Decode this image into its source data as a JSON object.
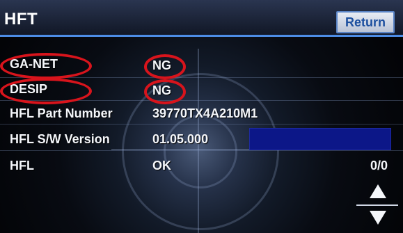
{
  "header": {
    "title": "HFT",
    "return_label": "Return"
  },
  "rows": [
    {
      "label": "GA-NET",
      "value": "NG"
    },
    {
      "label": "DESIP",
      "value": "NG"
    },
    {
      "label": "HFL Part Number",
      "value": "39770TX4A210M1"
    },
    {
      "label": "HFL S/W Version",
      "value": "01.05.000"
    },
    {
      "label": "HFL",
      "value": "OK"
    }
  ],
  "page_counter": "0/0",
  "controls": {
    "scroll_up_icon": "triangle-up",
    "scroll_down_icon": "triangle-down"
  },
  "colors": {
    "header_underline": "#4d8de6",
    "return_text": "#1c4f9f",
    "highlight_circle": "#d8141c",
    "progress_bar": "#0c1788"
  }
}
